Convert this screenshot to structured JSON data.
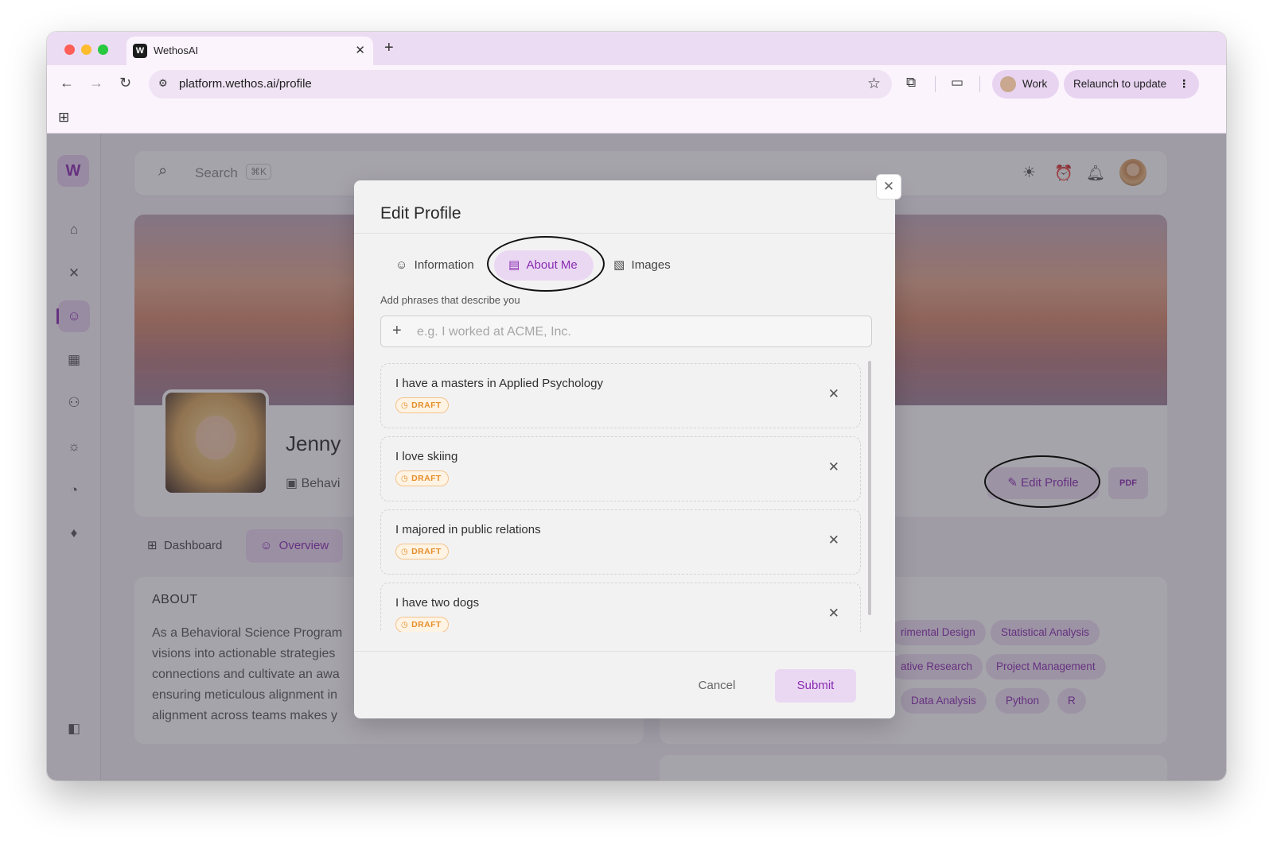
{
  "browser": {
    "tab_title": "WethosAI",
    "url": "platform.wethos.ai/profile",
    "profile_label": "Work",
    "relaunch_label": "Relaunch to update"
  },
  "app": {
    "search_label": "Search",
    "search_shortcut": "⌘K",
    "profile_name": "Jenny",
    "profile_role": "Behavi",
    "edit_profile_label": "Edit Profile",
    "pdf_label": "PDF",
    "tabs": [
      {
        "label": "Dashboard"
      },
      {
        "label": "Overview"
      }
    ],
    "about_heading": "ABOUT",
    "about_lines": [
      "As a Behavioral Science Program",
      "visions into actionable strategies",
      "connections and cultivate an awa",
      "ensuring meticulous alignment in",
      "alignment across teams makes y"
    ],
    "skills": [
      "rimental Design",
      "Statistical Analysis",
      "ative Research",
      "Project Management",
      "Data Analysis",
      "Python",
      "R"
    ]
  },
  "modal": {
    "title": "Edit Profile",
    "tabs": [
      {
        "label": "Information"
      },
      {
        "label": "About Me"
      },
      {
        "label": "Images"
      }
    ],
    "hint": "Add phrases that describe you",
    "input_placeholder": "e.g. I worked at ACME, Inc.",
    "items": [
      {
        "text": "I have a masters in Applied Psychology",
        "status": "DRAFT"
      },
      {
        "text": "I love skiing",
        "status": "DRAFT"
      },
      {
        "text": "I majored in public relations",
        "status": "DRAFT"
      },
      {
        "text": "I have two dogs",
        "status": "DRAFT"
      }
    ],
    "cancel_label": "Cancel",
    "submit_label": "Submit"
  },
  "colors": {
    "accent": "#8a2bb0",
    "accent_bg": "#ead8f3",
    "draft": "#e5902c"
  }
}
